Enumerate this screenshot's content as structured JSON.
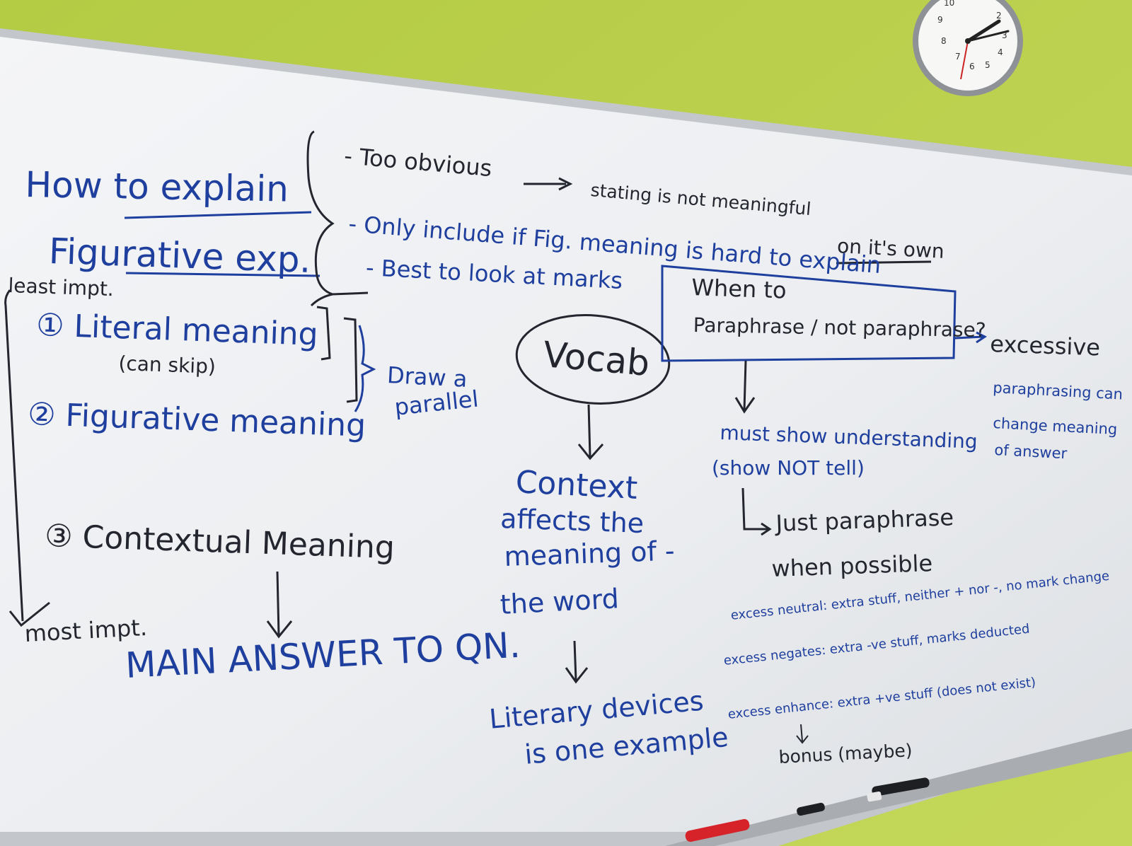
{
  "clock": {
    "numbers": [
      "10",
      "9",
      "8",
      "7",
      "6",
      "5",
      "4",
      "3",
      "2"
    ]
  },
  "board": {
    "title_line1": "How to explain",
    "title_line2": "Figurative exp.",
    "least_impt": "least impt.",
    "bracket_notes": [
      "- Too obvious",
      "stating is not meaningful",
      "- Only include if Fig. meaning is hard to explain",
      "on it's own",
      "- Best to look at marks"
    ],
    "steps": {
      "step1": "① Literal meaning",
      "step1_note": "(can skip)",
      "step2": "② Figurative meaning",
      "draw_parallel_1": "Draw a",
      "draw_parallel_2": "parallel",
      "step3": "③ Contextual Meaning",
      "most_impt": "most impt.",
      "main_answer": "MAIN ANSWER TO QN."
    },
    "vocab": {
      "bubble": "Vocab",
      "context": "Context",
      "line1": "affects the",
      "line2": "meaning of -",
      "line3": "the word",
      "literary1": "Literary devices",
      "literary2": "is one example"
    },
    "paraphrase": {
      "box_line1": "When to",
      "box_line2": "Paraphrase / not paraphrase?",
      "excessive": "excessive",
      "note1": "paraphrasing can",
      "note2": "change meaning",
      "note3": "of answer",
      "must1": "must show understanding",
      "must2": "(show NOT tell)",
      "just1": "Just paraphrase",
      "just2": "when possible",
      "excess_neutral": "excess neutral: extra stuff, neither + nor -, no mark change",
      "excess_negates": "excess negates: extra -ve stuff, marks deducted",
      "excess_enhance": "excess enhance: extra +ve stuff (does not exist)",
      "bonus": "bonus (maybe)"
    }
  }
}
